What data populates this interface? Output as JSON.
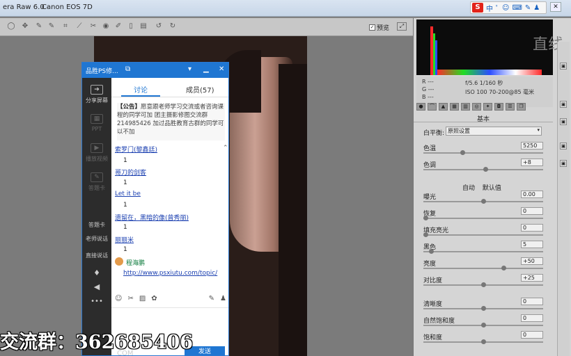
{
  "window": {
    "title": "era Raw 6.0 -",
    "camera": "Canon EOS 7D",
    "ime_labels": [
      "中",
      "ﾟ",
      "☺",
      "⌨",
      "✎",
      "♟"
    ]
  },
  "toolbar": {
    "preview_label": "预览",
    "icons": [
      "zoom-icon",
      "hand-icon",
      "white-balance-icon",
      "color-sampler-icon",
      "crop-icon",
      "straighten-icon",
      "spot-removal-icon",
      "redeye-icon",
      "adjustment-brush-icon",
      "graduated-filter-icon",
      "preferences-icon",
      "rotate-left-icon",
      "rotate-right-icon"
    ]
  },
  "histogram": {
    "colors": {
      "red": "#ff2a2a",
      "green": "#22dd22",
      "blue": "#2a4cff",
      "white": "#ffffff"
    }
  },
  "info": {
    "rgb": [
      "R",
      "G",
      "B"
    ],
    "rgb_values": [
      "---",
      "---",
      "---"
    ],
    "exposure": "f/5.6  1/160 秒",
    "iso": "ISO 100   70-200@85 毫米"
  },
  "panel": {
    "section_title": "基本",
    "wb_label": "白平衡:",
    "wb_value": "原照设置",
    "auto": "自动",
    "default": "默认值",
    "sliders": [
      {
        "label": "色温",
        "value": "5250",
        "pos": 0.32
      },
      {
        "label": "色调",
        "value": "+8",
        "pos": 0.52
      },
      {
        "label": "曝光",
        "value": "0.00",
        "pos": 0.5
      },
      {
        "label": "恢复",
        "value": "0",
        "pos": 0.0
      },
      {
        "label": "填充亮光",
        "value": "0",
        "pos": 0.0
      },
      {
        "label": "黑色",
        "value": "5",
        "pos": 0.05
      },
      {
        "label": "亮度",
        "value": "+50",
        "pos": 0.68
      },
      {
        "label": "对比度",
        "value": "+25",
        "pos": 0.5
      },
      {
        "label": "清晰度",
        "value": "0",
        "pos": 0.5
      },
      {
        "label": "自然饱和度",
        "value": "0",
        "pos": 0.5
      },
      {
        "label": "饱和度",
        "value": "0",
        "pos": 0.5
      }
    ]
  },
  "watermark": "直线",
  "chat": {
    "title": "品胜PS修...",
    "tabs": {
      "discussion": "讨论",
      "members": "成员(57)"
    },
    "side": [
      {
        "label": "分享屏幕",
        "dim": false
      },
      {
        "label": "PPT",
        "dim": true
      },
      {
        "label": "播放视频",
        "dim": true
      },
      {
        "label": "答题卡",
        "dim": true
      },
      {
        "label": "答题卡",
        "dim": false
      },
      {
        "label": "老师说话",
        "dim": false
      },
      {
        "label": "直接说话",
        "dim": false
      }
    ],
    "notice": {
      "tag": "【公告】",
      "text": "愿意跟老师学习交流或者咨询课程的同学可加 团主摄影修图交流群 214985426 加过品胜教育古群的同学可以不加"
    },
    "messages": [
      {
        "name": "索罗门(黎鑫廷)",
        "text": "1"
      },
      {
        "name": "哥刀的剑客",
        "text": "1"
      },
      {
        "name": "Let it be",
        "text": "1"
      },
      {
        "name": "遗留在，黑暗的像(曾秀丽)",
        "text": "1"
      },
      {
        "name": "丽丽米",
        "text": "1"
      }
    ],
    "last": {
      "name": "程海鹏",
      "link": "http://www.psxiutu.com/topic/"
    },
    "input_hint": "COM",
    "send": "发送"
  },
  "caption": "交流群：362685406"
}
